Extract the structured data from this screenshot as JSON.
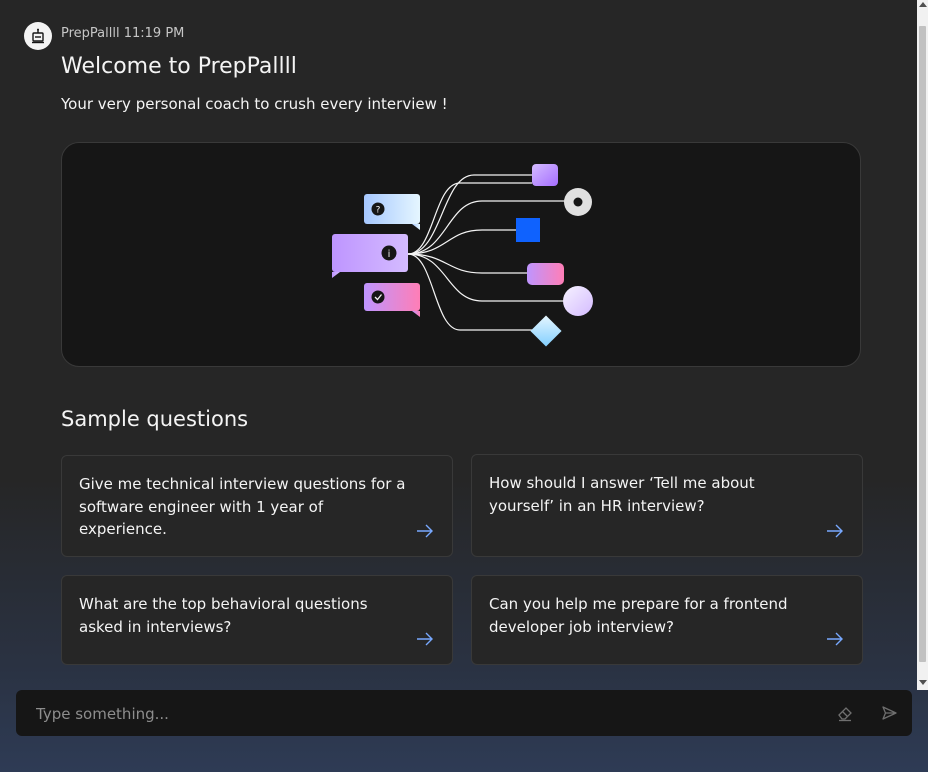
{
  "message": {
    "sender": "PrepPallll",
    "time": "11:19 PM",
    "title": "Welcome to PrepPallll",
    "subtitle": "Your very personal coach to crush every interview !"
  },
  "sample_questions": {
    "heading": "Sample questions",
    "items": [
      {
        "text": "Give me technical interview questions for a software engineer with 1 year of experience."
      },
      {
        "text": "How should I answer ‘Tell me about yourself’ in an HR interview?"
      },
      {
        "text": "What are the top behavioral questions asked in interviews?"
      },
      {
        "text": "Can you help me prepare for a frontend developer job interview?"
      }
    ]
  },
  "input": {
    "placeholder": "Type something..."
  },
  "icons": {
    "avatar": "robot-icon",
    "arrow": "arrow-right-icon",
    "clear": "eraser-icon",
    "send": "send-icon"
  },
  "colors": {
    "accent_blue": "#0f62fe",
    "arrow_blue": "#78a9ff",
    "purple": "#be95ff",
    "pink": "#ff7eb6",
    "light_blue": "#a6c8ff"
  }
}
